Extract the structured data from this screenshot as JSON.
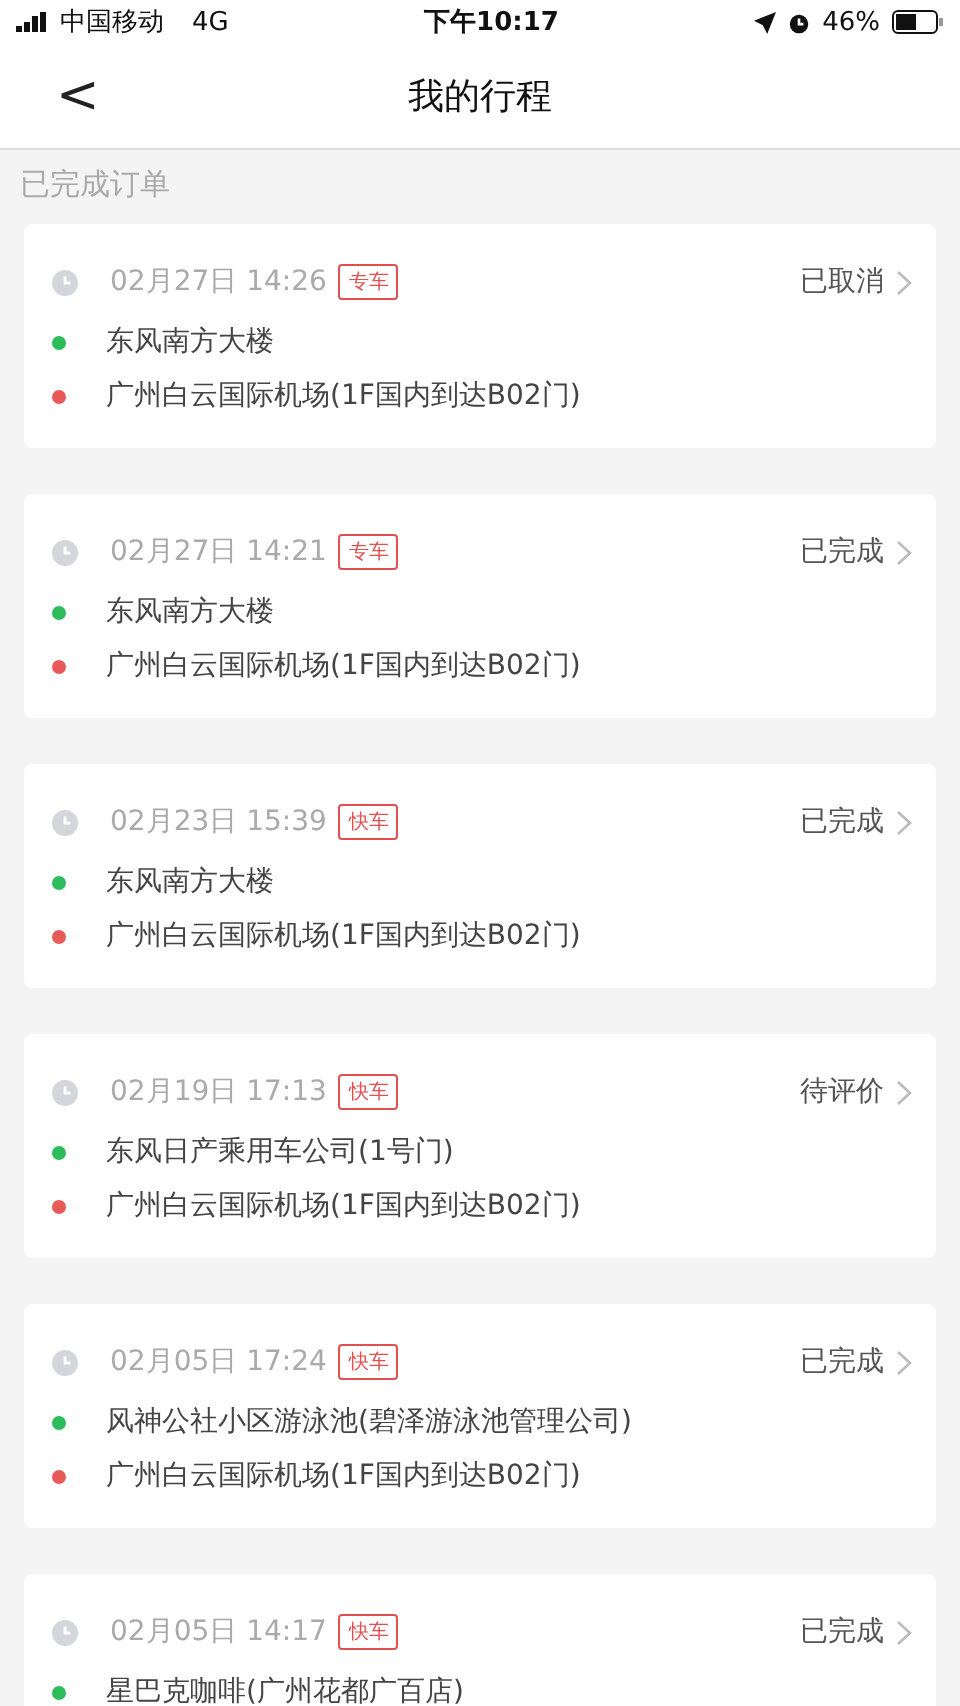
{
  "status_bar": {
    "carrier": "中国移动",
    "network": "4G",
    "time": "下午10:17",
    "battery": "46%"
  },
  "nav": {
    "back": "<",
    "title": "我的行程"
  },
  "section_title": "已完成订单",
  "trips": [
    {
      "time": "02月27日 14:26",
      "type": "专车",
      "status": "已取消",
      "from": "东风南方大楼",
      "to": "广州白云国际机场(1F国内到达B02门)"
    },
    {
      "time": "02月27日 14:21",
      "type": "专车",
      "status": "已完成",
      "from": "东风南方大楼",
      "to": "广州白云国际机场(1F国内到达B02门)"
    },
    {
      "time": "02月23日 15:39",
      "type": "快车",
      "status": "已完成",
      "from": "东风南方大楼",
      "to": "广州白云国际机场(1F国内到达B02门)"
    },
    {
      "time": "02月19日 17:13",
      "type": "快车",
      "status": "待评价",
      "from": "东风日产乘用车公司(1号门)",
      "to": "广州白云国际机场(1F国内到达B02门)"
    },
    {
      "time": "02月05日 17:24",
      "type": "快车",
      "status": "已完成",
      "from": "风神公社小区游泳池(碧泽游泳池管理公司)",
      "to": "广州白云国际机场(1F国内到达B02门)"
    },
    {
      "time": "02月05日 14:17",
      "type": "快车",
      "status": "已完成",
      "from": "星巴克咖啡(广州花都广百店)"
    }
  ]
}
